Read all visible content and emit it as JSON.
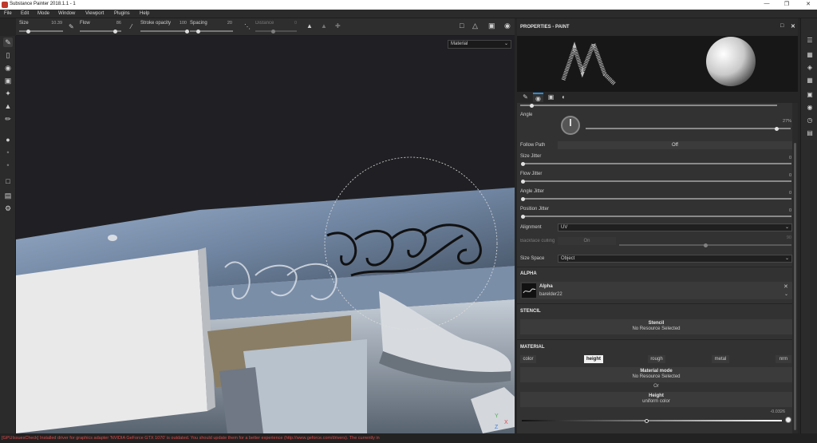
{
  "window": {
    "title": "Substance Painter 2018.1.1 - 1",
    "minimize": "—",
    "maximize": "❐",
    "close": "✕"
  },
  "menu": [
    "File",
    "Edit",
    "Mode",
    "Window",
    "Viewport",
    "Plugins",
    "Help"
  ],
  "toolbar": {
    "size_label": "Size",
    "size_value": "10.39",
    "size_fraction": 0.2,
    "flow_label": "Flow",
    "flow_value": "86",
    "flow_fraction": 0.86,
    "stroke_opacity_label": "Stroke opacity",
    "stroke_opacity_value": "100",
    "stroke_opacity_fraction": 1.0,
    "spacing_label": "Spacing",
    "spacing_value": "20",
    "spacing_fraction": 0.2,
    "distance_label": "Distance",
    "distance_value": "0"
  },
  "viewport": {
    "channel_select": "Material"
  },
  "panel": {
    "title": "PROPERTIES - PAINT",
    "angle_label": "Angle",
    "angle_value": "27%",
    "angle_fraction": 0.93,
    "follow_path_label": "Follow Path",
    "follow_path_value": "Off",
    "size_jitter_label": "Size Jitter",
    "size_jitter_value": "0",
    "flow_jitter_label": "Flow Jitter",
    "flow_jitter_value": "0",
    "angle_jitter_label": "Angle Jitter",
    "angle_jitter_value": "0",
    "position_jitter_label": "Position Jitter",
    "position_jitter_value": "0",
    "alignment_label": "Alignment",
    "alignment_value": "UV",
    "backface_label": "Backface culling",
    "backface_value": "On",
    "backface_num": "90",
    "size_space_label": "Size Space",
    "size_space_value": "Object",
    "alpha_section": "ALPHA",
    "alpha_title": "Alpha",
    "alpha_resource": "barelder22",
    "stencil_section": "STENCIL",
    "stencil_title": "Stencil",
    "stencil_value": "No Resource Selected",
    "material_section": "MATERIAL",
    "channels": [
      {
        "label": "color",
        "active": false
      },
      {
        "label": "height",
        "active": true
      },
      {
        "label": "rough",
        "active": false
      },
      {
        "label": "metal",
        "active": false
      },
      {
        "label": "nrm",
        "active": false
      }
    ],
    "material_mode_title": "Material mode",
    "material_mode_value": "No Resource Selected",
    "or_text": "Or",
    "height_title": "Height",
    "height_subtitle": "uniform color",
    "height_value": "-0.0326",
    "height_fraction": 0.48
  },
  "status": {
    "message": "[GPUIssuesCheck] Installed driver for graphics adapter 'NVIDIA GeForce GTX 1070' is outdated. You should update them for a better experience (http://www.geforce.com/drivers). The currently in"
  },
  "colors": {
    "accent": "#2a8bd8",
    "status_error": "#e04848"
  }
}
